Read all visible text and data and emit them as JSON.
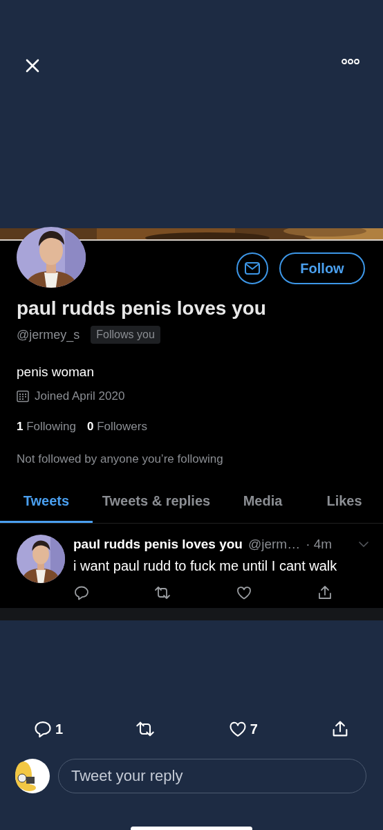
{
  "profile": {
    "follow_button": "Follow",
    "name": "paul rudds penis loves you",
    "handle": "@jermey_s",
    "badge": "Follows you",
    "bio": "penis woman",
    "joined": "Joined April 2020",
    "stats": [
      {
        "count": "1",
        "label": "Following"
      },
      {
        "count": "0",
        "label": "Followers"
      }
    ],
    "note": "Not followed by anyone you’re following"
  },
  "tabs": [
    {
      "label": "Tweets",
      "selected": true
    },
    {
      "label": "Tweets & replies",
      "selected": false
    },
    {
      "label": "Media",
      "selected": false
    },
    {
      "label": "Likes",
      "selected": false
    }
  ],
  "tweet": {
    "name": "paul rudds penis loves you",
    "handle": "@jerm…",
    "time": "· 4m",
    "text": "i want paul rudd to fuck me until I cant walk"
  },
  "actions": [
    {
      "kind": "reply",
      "count": "1"
    },
    {
      "kind": "retweet"
    },
    {
      "kind": "like",
      "count": "7"
    },
    {
      "kind": "share"
    }
  ],
  "reply_field": {
    "placeholder": "Tweet your reply"
  }
}
